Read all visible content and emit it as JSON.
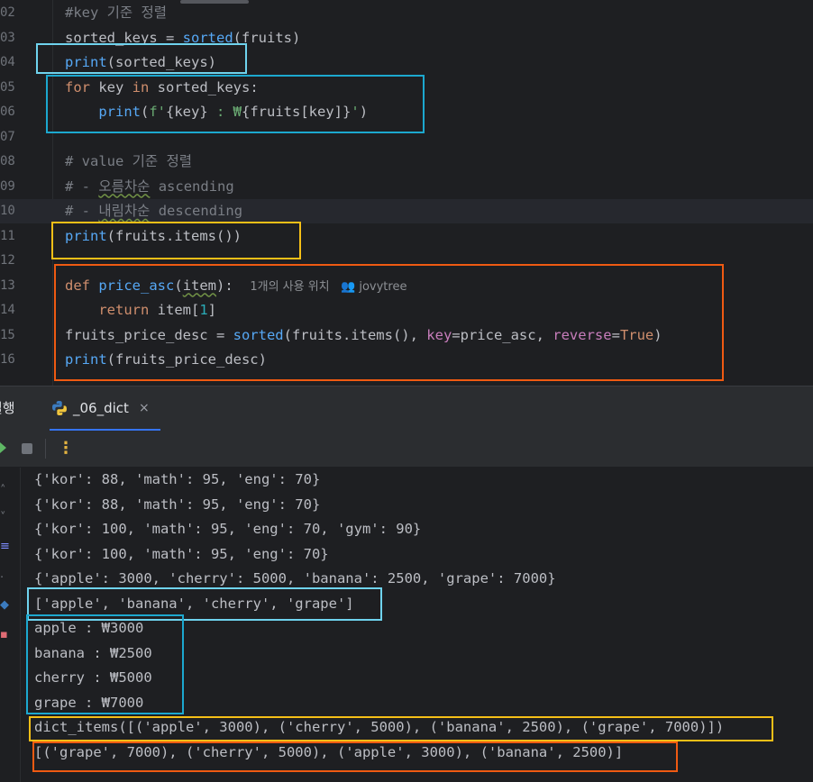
{
  "editor": {
    "lines": [
      {
        "num": "02",
        "highlight": false,
        "tokens": [
          {
            "t": "#key 기준 정렬",
            "c": "cmt"
          }
        ]
      },
      {
        "num": "03",
        "highlight": false,
        "tokens": [
          {
            "t": "sorted_keys = ",
            "c": "id"
          },
          {
            "t": "sorted",
            "c": "fn"
          },
          {
            "t": "(fruits)",
            "c": "id"
          }
        ]
      },
      {
        "num": "04",
        "highlight": false,
        "tokens": [
          {
            "t": "print",
            "c": "fn"
          },
          {
            "t": "(sorted_keys)",
            "c": "id"
          }
        ]
      },
      {
        "num": "05",
        "highlight": false,
        "tokens": [
          {
            "t": "for",
            "c": "kw"
          },
          {
            "t": " key ",
            "c": "id"
          },
          {
            "t": "in",
            "c": "kw"
          },
          {
            "t": " sorted_keys:",
            "c": "id"
          }
        ]
      },
      {
        "num": "06",
        "highlight": false,
        "tokens": [
          {
            "t": "    ",
            "c": "id"
          },
          {
            "t": "print",
            "c": "fn"
          },
          {
            "t": "(",
            "c": "id"
          },
          {
            "t": "f'",
            "c": "str"
          },
          {
            "t": "{key}",
            "c": "id"
          },
          {
            "t": " : ₩",
            "c": "str"
          },
          {
            "t": "{fruits[key]}",
            "c": "id"
          },
          {
            "t": "'",
            "c": "str"
          },
          {
            "t": ")",
            "c": "id"
          }
        ]
      },
      {
        "num": "07",
        "highlight": false,
        "tokens": []
      },
      {
        "num": "08",
        "highlight": false,
        "tokens": [
          {
            "t": "# value 기준 정렬",
            "c": "cmt"
          }
        ]
      },
      {
        "num": "09",
        "highlight": false,
        "tokens": [
          {
            "t": "# - ",
            "c": "cmt"
          },
          {
            "t": "오름차순",
            "c": "cmt wavy"
          },
          {
            "t": " ascending",
            "c": "cmt"
          }
        ]
      },
      {
        "num": "10",
        "highlight": true,
        "tokens": [
          {
            "t": "# - ",
            "c": "cmt"
          },
          {
            "t": "내림차순",
            "c": "cmt wavy"
          },
          {
            "t": " descending",
            "c": "cmt"
          }
        ]
      },
      {
        "num": "11",
        "highlight": false,
        "tokens": [
          {
            "t": "print",
            "c": "fn"
          },
          {
            "t": "(fruits.items())",
            "c": "id"
          }
        ]
      },
      {
        "num": "12",
        "highlight": false,
        "tokens": []
      },
      {
        "num": "13",
        "highlight": false,
        "tokens": [
          {
            "t": "def",
            "c": "kw"
          },
          {
            "t": " ",
            "c": "id"
          },
          {
            "t": "price_asc",
            "c": "fn"
          },
          {
            "t": "(",
            "c": "id"
          },
          {
            "t": "item",
            "c": "id wavy"
          },
          {
            "t": "):  ",
            "c": "id"
          },
          {
            "t": "1개의 사용 위치   👥 jovytree",
            "c": "hint"
          }
        ]
      },
      {
        "num": "14",
        "highlight": false,
        "tokens": [
          {
            "t": "    ",
            "c": "id"
          },
          {
            "t": "return",
            "c": "kw"
          },
          {
            "t": " item[",
            "c": "id"
          },
          {
            "t": "1",
            "c": "num"
          },
          {
            "t": "]",
            "c": "id"
          }
        ]
      },
      {
        "num": "15",
        "highlight": false,
        "tokens": [
          {
            "t": "fruits_price_desc = ",
            "c": "id"
          },
          {
            "t": "sorted",
            "c": "fn"
          },
          {
            "t": "(fruits.items(), ",
            "c": "id"
          },
          {
            "t": "key",
            "c": "param"
          },
          {
            "t": "=price_asc, ",
            "c": "id"
          },
          {
            "t": "reverse",
            "c": "param"
          },
          {
            "t": "=",
            "c": "id"
          },
          {
            "t": "True",
            "c": "kw"
          },
          {
            "t": ")",
            "c": "id"
          }
        ]
      },
      {
        "num": "16",
        "highlight": false,
        "tokens": [
          {
            "t": "print",
            "c": "fn"
          },
          {
            "t": "(fruits_price_desc)",
            "c": "id"
          }
        ]
      }
    ]
  },
  "tabs": {
    "run_label": "실행",
    "file_label": "_06_dict",
    "close_glyph": "×"
  },
  "toolbar": {
    "more_glyph": "⋮"
  },
  "console": {
    "lines": [
      "{'kor': 88, 'math': 95, 'eng': 70}",
      "{'kor': 88, 'math': 95, 'eng': 70}",
      "{'kor': 100, 'math': 95, 'eng': 70, 'gym': 90}",
      "{'kor': 100, 'math': 95, 'eng': 70}",
      "{'apple': 3000, 'cherry': 5000, 'banana': 2500, 'grape': 7000}",
      "['apple', 'banana', 'cherry', 'grape']",
      "apple : ₩3000",
      "banana : ₩2500",
      "cherry : ₩5000",
      "grape : ₩7000",
      "dict_items([('apple', 3000), ('cherry', 5000), ('banana', 2500), ('grape', 7000)])",
      "[('grape', 7000), ('cherry', 5000), ('apple', 3000), ('banana', 2500)]"
    ]
  },
  "annotation_colors": {
    "cyan": "#1ca8cf",
    "cyan_light": "#6fd3ee",
    "yellow": "#f5bf17",
    "orange": "#ef5a12"
  }
}
